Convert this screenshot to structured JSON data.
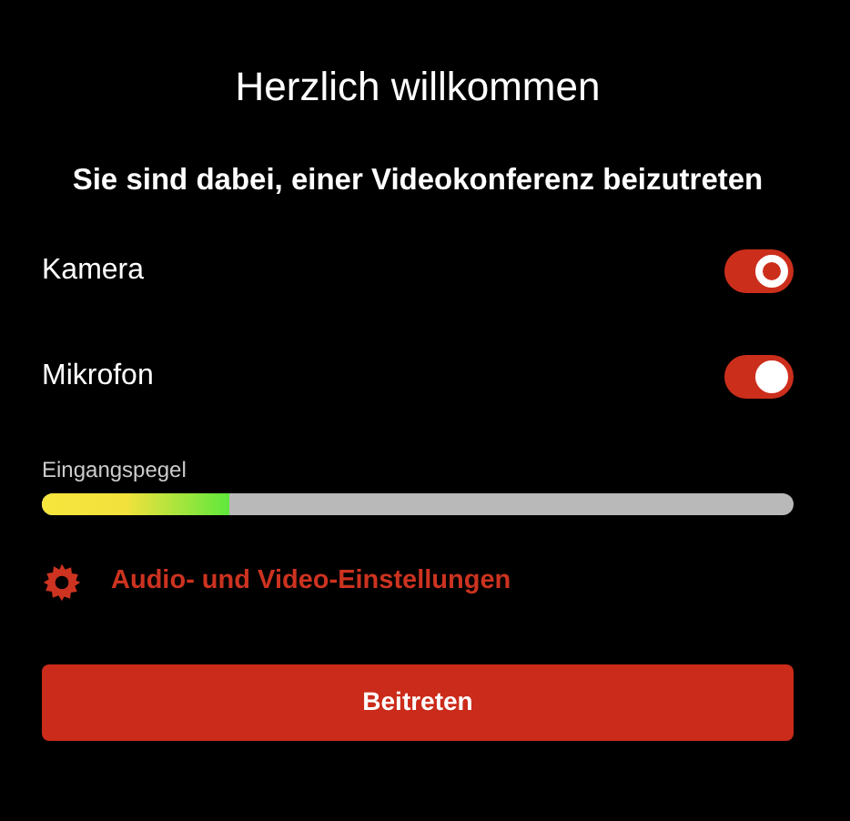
{
  "title": "Herzlich willkommen",
  "subtitle": "Sie sind dabei, einer Videokonferenz beizutreten",
  "toggles": [
    {
      "label": "Kamera",
      "on": true,
      "focused": true
    },
    {
      "label": "Mikrofon",
      "on": true,
      "focused": false
    }
  ],
  "meter": {
    "label": "Eingangspegel",
    "level": 0.25
  },
  "settings_link": "Audio- und Video-Einstellungen",
  "join_button": "Beitreten"
}
